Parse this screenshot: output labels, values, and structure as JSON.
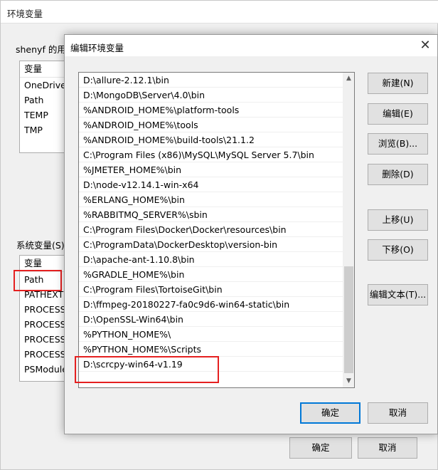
{
  "bg_dialog": {
    "title": "环境变量",
    "user_group_label": "shenyf 的用户",
    "user_list_header": "变量",
    "user_vars": [
      "OneDrive",
      "Path",
      "TEMP",
      "TMP"
    ],
    "system_group_label": "系统变量(S)",
    "system_list_header": "变量",
    "system_vars": [
      "Path",
      "PATHEXT",
      "PROCESSO",
      "PROCESSO",
      "PROCESSO",
      "PROCESSO",
      "PSModule"
    ],
    "ok_label": "确定",
    "cancel_label": "取消"
  },
  "edit_dialog": {
    "title": "编辑环境变量",
    "close_glyph": "✕",
    "entries": [
      "D:\\allure-2.12.1\\bin",
      "D:\\MongoDB\\Server\\4.0\\bin",
      "%ANDROID_HOME%\\platform-tools",
      "%ANDROID_HOME%\\tools",
      "%ANDROID_HOME%\\build-tools\\21.1.2",
      "C:\\Program Files (x86)\\MySQL\\MySQL Server 5.7\\bin",
      "%JMETER_HOME%\\bin",
      "D:\\node-v12.14.1-win-x64",
      "%ERLANG_HOME%\\bin",
      "%RABBITMQ_SERVER%\\sbin",
      "C:\\Program Files\\Docker\\Docker\\resources\\bin",
      "C:\\ProgramData\\DockerDesktop\\version-bin",
      "D:\\apache-ant-1.10.8\\bin",
      "%GRADLE_HOME%\\bin",
      "C:\\Program Files\\TortoiseGit\\bin",
      "D:\\ffmpeg-20180227-fa0c9d6-win64-static\\bin",
      "D:\\OpenSSL-Win64\\bin",
      "%PYTHON_HOME%\\",
      "%PYTHON_HOME%\\Scripts",
      "D:\\scrcpy-win64-v1.19"
    ],
    "buttons": {
      "new": "新建(N)",
      "edit": "编辑(E)",
      "browse": "浏览(B)...",
      "delete": "删除(D)",
      "move_up": "上移(U)",
      "move_down": "下移(O)",
      "edit_text": "编辑文本(T)..."
    },
    "ok_label": "确定",
    "cancel_label": "取消",
    "scroll_position": 0.6
  },
  "colors": {
    "highlight_red": "#e52020",
    "default_button_border": "#0078d7"
  }
}
